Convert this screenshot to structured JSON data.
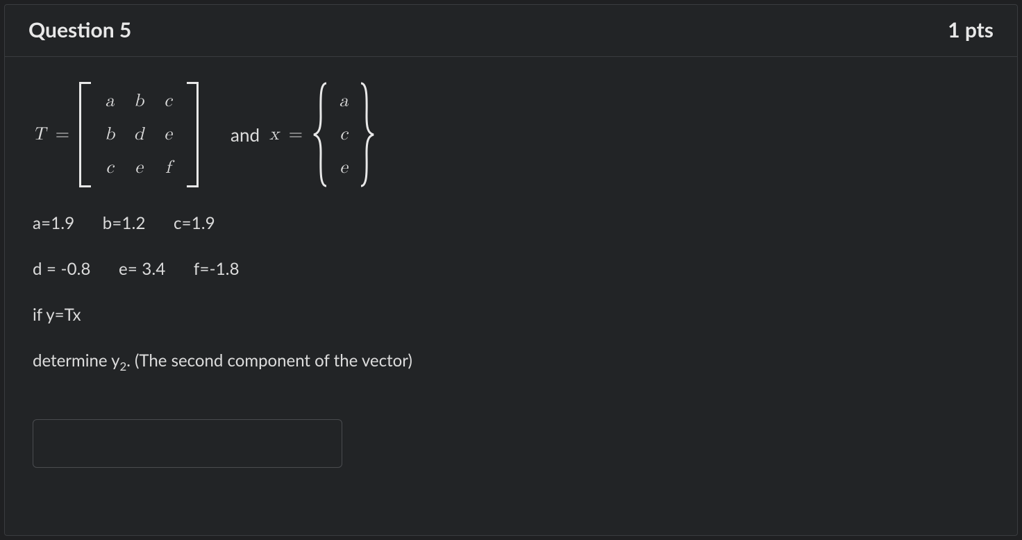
{
  "header": {
    "title": "Question 5",
    "points": "1 pts"
  },
  "math": {
    "T_label": "T",
    "eq": "=",
    "matrix": {
      "r1c1": "a",
      "r1c2": "b",
      "r1c3": "c",
      "r2c1": "b",
      "r2c2": "d",
      "r2c3": "e",
      "r3c1": "c",
      "r3c2": "e",
      "r3c3": "f"
    },
    "and_label": "and",
    "x_label": "x",
    "vector": {
      "v1": "a",
      "v2": "c",
      "v3": "e"
    }
  },
  "values1": {
    "a": "a=1.9",
    "b": "b=1.2",
    "c": "c=1.9"
  },
  "values2": {
    "d": "d = -0.8",
    "e": "e= 3.4",
    "f": "f=-1.8"
  },
  "line_if": "if y=Tx",
  "line_det_pre": " determine y",
  "line_det_sub": "2",
  "line_det_post": ". (The second component of the vector)",
  "answer": {
    "value": "",
    "placeholder": ""
  }
}
